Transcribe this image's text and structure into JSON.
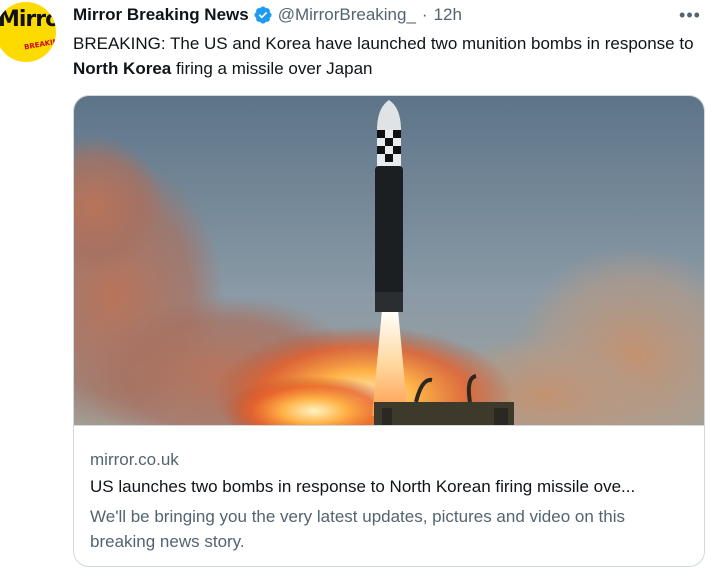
{
  "author": {
    "name": "Mirror Breaking News",
    "handle": "@MirrorBreaking_",
    "separator": "·",
    "time": "12h",
    "avatar_logo_text": "Mirror",
    "avatar_sub_text": "BREAKING",
    "verified_icon": "verified-badge-icon"
  },
  "more_icon": "more-horizontal-icon",
  "more_glyph": "•••",
  "tweet": {
    "text_before": "BREAKING: The US and Korea have launched two munition bombs in response to ",
    "text_bold": "North Korea",
    "text_after": " firing a missile over Japan"
  },
  "card": {
    "domain": "mirror.co.uk",
    "title": "US launches two bombs in response to North Korean firing missile ove...",
    "description": "We'll be bringing you the very latest updates, pictures and video on this breaking news story."
  },
  "colors": {
    "text_primary": "#0f1419",
    "text_secondary": "#536471",
    "verified_blue": "#1d9bf0",
    "brand_yellow": "#fddb00",
    "border": "#cfd9de"
  }
}
